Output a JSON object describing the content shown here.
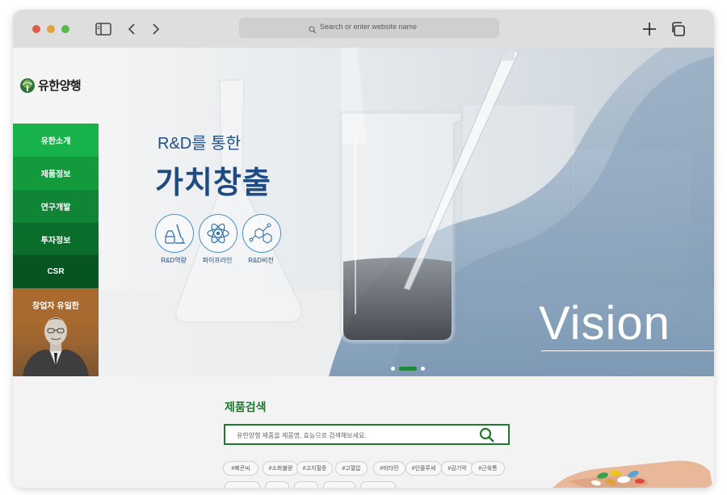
{
  "browser": {
    "url_placeholder": "Search or enter website name"
  },
  "sidebar": {
    "logo_text": "유한양행",
    "items": [
      {
        "label": "유한소개",
        "color": "#17b24a"
      },
      {
        "label": "제품정보",
        "color": "#129a3c"
      },
      {
        "label": "연구개발",
        "color": "#0f8535"
      },
      {
        "label": "투자정보",
        "color": "#0b6d2b"
      },
      {
        "label": "CSR",
        "color": "#075423"
      }
    ],
    "founder_label": "창업자 유일한"
  },
  "hero": {
    "subtitle": "R&D를 통한",
    "title": "가치창출",
    "icons": [
      {
        "label": "R&D역량",
        "icon": "microscope-icon"
      },
      {
        "label": "파이프라인",
        "icon": "atom-icon"
      },
      {
        "label": "R&D비전",
        "icon": "molecule-icon"
      }
    ],
    "vision_text": "Vision",
    "slides": 3,
    "active_slide": 2
  },
  "product_search": {
    "title": "제품검색",
    "placeholder": "유한양행 제품을 제품명, 효능으로 검색해보세요.",
    "tags": [
      "#삐콘씨",
      "#소화불량",
      "#고지혈증",
      "#고혈압",
      "#비타민",
      "#인플루세",
      "#감기약",
      "#근육통"
    ]
  },
  "colors": {
    "brand_green": "#1f7a2d",
    "hero_blue": "#1e4b82"
  }
}
